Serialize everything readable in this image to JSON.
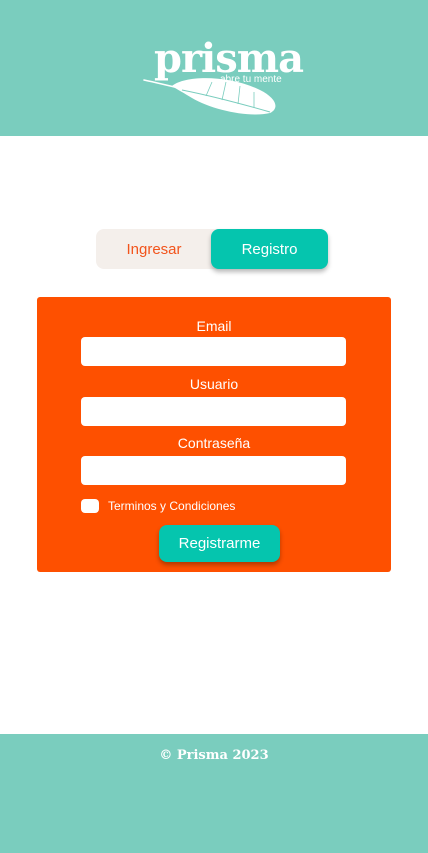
{
  "brand": {
    "name": "prisma",
    "tagline": "abre tu mente",
    "logo_icon": "feather-icon"
  },
  "tabs": [
    {
      "label": "Ingresar",
      "active": false
    },
    {
      "label": "Registro",
      "active": true
    }
  ],
  "form": {
    "email_label": "Email",
    "email_value": "",
    "username_label": "Usuario",
    "username_value": "",
    "password_label": "Contraseña",
    "password_value": "",
    "terms_label": "Terminos y Condiciones",
    "terms_checked": false,
    "submit_label": "Registrarme"
  },
  "footer": {
    "copyright": "© Prisma 2023"
  },
  "colors": {
    "header_footer": "#7ACDBE",
    "accent_teal": "#05C5AE",
    "card_orange": "#FE5000",
    "tab_inactive_text": "#F2541C",
    "tab_bar_bg": "#F4EFEB"
  }
}
